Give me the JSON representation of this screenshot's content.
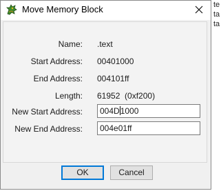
{
  "window": {
    "title": "Move Memory Block"
  },
  "fields": {
    "name": {
      "label": "Name:",
      "value": ".text"
    },
    "start": {
      "label": "Start Address:",
      "value": "00401000"
    },
    "end": {
      "label": "End Address:",
      "value": "004101ff"
    },
    "length": {
      "label": "Length:",
      "value": "61952",
      "hex": "(0xf200)"
    },
    "new_start": {
      "label": "New Start Address:",
      "value_before_caret": "004D",
      "value_after_caret": "1000"
    },
    "new_end": {
      "label": "New End Address:",
      "value": "004e01ff"
    }
  },
  "buttons": {
    "ok": "OK",
    "cancel": "Cancel"
  },
  "background_text": [
    "te",
    "ta",
    "ta"
  ]
}
